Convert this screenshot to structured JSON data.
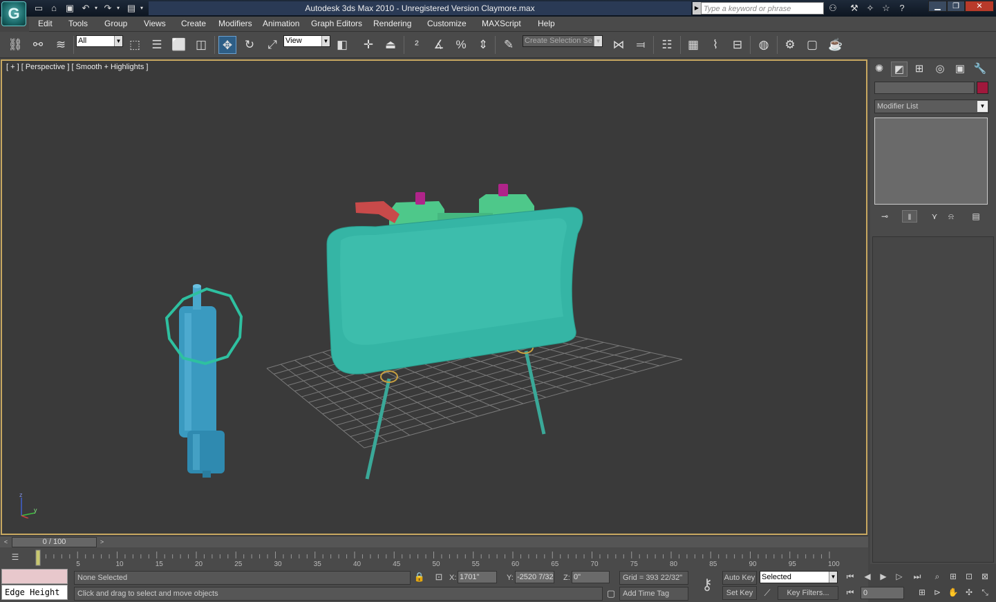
{
  "titlebar": {
    "logo": "G",
    "title": "Autodesk 3ds Max  2010    - Unregistered Version       Claymore.max",
    "search_placeholder": "Type a keyword or phrase",
    "qat_icons": [
      "new-file-icon",
      "open-file-icon",
      "save-icon",
      "undo-icon",
      "redo-icon",
      "project-folder-icon"
    ],
    "help_icons": [
      "binoculars-icon",
      "tools-icon",
      "communication-center-icon",
      "favorites-star-icon",
      "help-icon"
    ],
    "window_buttons": [
      "minimize-icon",
      "restore-icon",
      "close-icon"
    ]
  },
  "menu": {
    "items": [
      "Edit",
      "Tools",
      "Group",
      "Views",
      "Create",
      "Modifiers",
      "Animation",
      "Graph Editors",
      "Rendering",
      "Customize",
      "MAXScript",
      "Help"
    ]
  },
  "toolbar": {
    "selection_filter": "All",
    "reference_coordinate": "View",
    "named_selection_placeholder": "Create Selection Se",
    "active_tool": "select-and-move-icon"
  },
  "viewport": {
    "label": "[ + ] [ Perspective ] [ Smooth + Highlights ]",
    "axis": {
      "z": "z",
      "y": "y"
    },
    "colors": {
      "background": "#3a3a3a",
      "border_active": "#c8a860",
      "mine_body": "#35b5a5",
      "mine_top": "#4ec88a",
      "lever": "#c84a4a",
      "knob": "#b0248a",
      "detonator": "#3a9ac0",
      "ring": "#2ec0a0"
    }
  },
  "command_panel": {
    "tabs": [
      "create-tab-icon",
      "modify-tab-icon",
      "hierarchy-tab-icon",
      "motion-tab-icon",
      "display-tab-icon",
      "utilities-tab-icon"
    ],
    "active_tab": "modify-tab-icon",
    "object_name": "",
    "object_color": "#a0183c",
    "modifier_list": "Modifier List",
    "stack_buttons": [
      "pin-stack-icon",
      "show-end-result-icon",
      "make-unique-icon",
      "remove-modifier-icon",
      "configure-modifier-sets-icon"
    ]
  },
  "time_slider": {
    "position": "0 / 100",
    "left_arrow": "<",
    "right_arrow": ">"
  },
  "track_bar": {
    "ticks": [
      "0",
      "5",
      "10",
      "15",
      "20",
      "25",
      "30",
      "35",
      "40",
      "45",
      "50",
      "55",
      "60",
      "65",
      "70",
      "75",
      "80",
      "85",
      "90",
      "95",
      "100"
    ]
  },
  "status": {
    "selection_info": "None Selected",
    "prompt": "Click and drag to select and move objects",
    "maxscript_line": "Edge Height",
    "x_label": "X:",
    "x_value": "1701\"",
    "y_label": "Y:",
    "y_value": "-2520 7/32",
    "z_label": "Z:",
    "z_value": "0\"",
    "grid": "Grid = 393 22/32\"",
    "add_time_tag": "Add Time Tag",
    "auto_key": "Auto Key",
    "set_key": "Set Key",
    "key_mode": "Selected",
    "key_filters": "Key Filters...",
    "current_frame": "0"
  }
}
